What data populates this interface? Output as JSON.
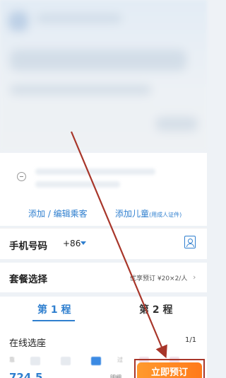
{
  "passengers": {
    "add_edit_label": "添加 / 编辑乘客",
    "add_child_label": "添加儿童",
    "add_child_note": "(用成人证件)"
  },
  "phone": {
    "label": "手机号码",
    "country_code": "+86"
  },
  "package": {
    "label": "套餐选择",
    "promo_text": "优享预订 ¥20×2/人",
    "chevron": "›"
  },
  "trips": {
    "tabs": [
      {
        "label": "第 1 程",
        "active": true
      },
      {
        "label": "第 2 程",
        "active": false
      }
    ]
  },
  "seat_selection": {
    "title": "在线选座",
    "count": "1/1",
    "row_label_left": "靠",
    "row_label_right": "过",
    "selected_seat": "C"
  },
  "footer": {
    "price": "724.5",
    "detail_label": "明细",
    "book_label": "立即预订"
  },
  "colors": {
    "accent": "#2f7fcf",
    "book_button": "#ff8a24",
    "annotation": "#a8362a"
  }
}
